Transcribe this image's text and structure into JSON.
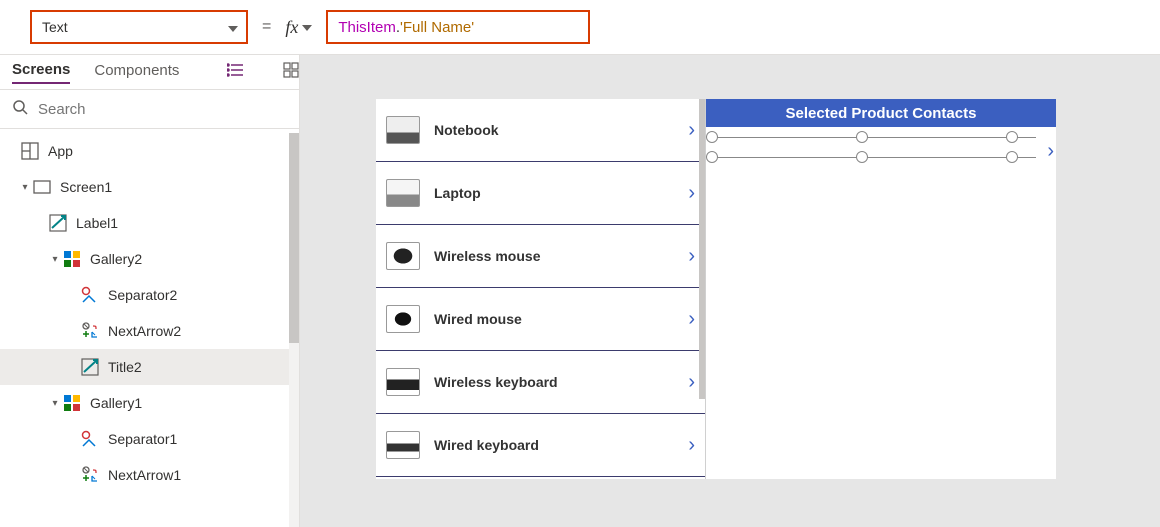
{
  "formula": {
    "property": "Text",
    "equals": "=",
    "fx": "fx",
    "expr_this": "ThisItem",
    "expr_dot": ".",
    "expr_prop": "'Full Name'"
  },
  "tree": {
    "tabs": {
      "screens": "Screens",
      "components": "Components"
    },
    "search_placeholder": "Search",
    "nodes": {
      "app": "App",
      "screen1": "Screen1",
      "label1": "Label1",
      "gallery2": "Gallery2",
      "separator2": "Separator2",
      "nextarrow2": "NextArrow2",
      "title2": "Title2",
      "gallery1": "Gallery1",
      "separator1": "Separator1",
      "nextarrow1": "NextArrow1"
    }
  },
  "canvas": {
    "header": "Selected Product Contacts",
    "items": [
      "Notebook",
      "Laptop",
      "Wireless mouse",
      "Wired mouse",
      "Wireless keyboard",
      "Wired keyboard"
    ]
  }
}
